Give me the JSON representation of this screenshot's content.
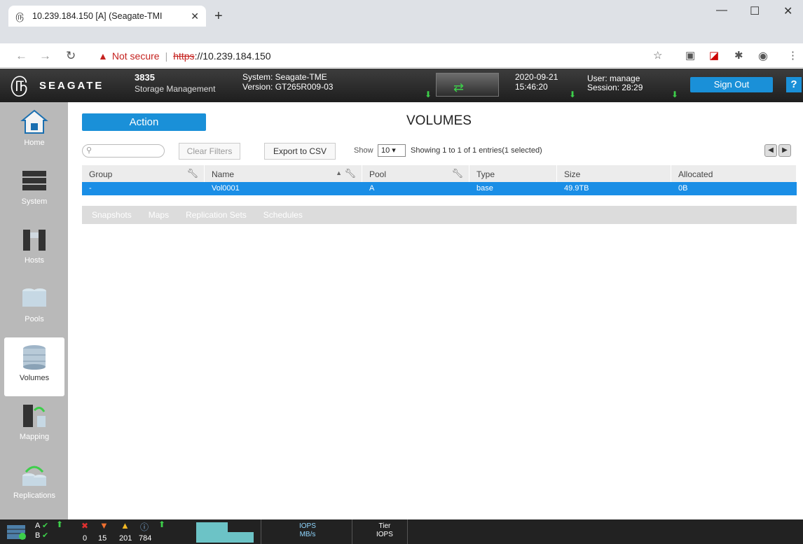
{
  "browser": {
    "tab_title": "10.239.184.150 [A] (Seagate-TMI",
    "new_tab": "+",
    "not_secure": "Not secure",
    "url_scheme": "https",
    "url_host": "://10.239.184.150",
    "window_min": "—",
    "window_max": "☐",
    "window_close": "✕"
  },
  "header": {
    "brand": "SEAGATE",
    "model": "3835",
    "product": "Storage Management",
    "system_label": "System: Seagate-TME",
    "version_label": "Version: GT265R009-03",
    "date": "2020-09-21",
    "time": "15:46:20",
    "user_label": "User: manage",
    "session_label": "Session: 28:29",
    "sign_out": "Sign Out",
    "help": "?"
  },
  "sidebar": {
    "items": [
      {
        "label": "Home"
      },
      {
        "label": "System"
      },
      {
        "label": "Hosts"
      },
      {
        "label": "Pools"
      },
      {
        "label": "Volumes"
      },
      {
        "label": "Mapping"
      },
      {
        "label": "Replications"
      }
    ]
  },
  "main": {
    "action": "Action",
    "title": "VOLUMES",
    "clear_filters": "Clear Filters",
    "export_csv": "Export to CSV",
    "show": "Show",
    "show_value": "10 ▾",
    "entries": "Showing 1 to 1 of 1 entries(1 selected)",
    "columns": [
      "Group",
      "Name",
      "Pool",
      "Type",
      "Size",
      "Allocated"
    ],
    "rows": [
      {
        "group": "-",
        "name": "Vol0001",
        "pool": "A",
        "type": "base",
        "size": "49.9TB",
        "allocated": "0B"
      }
    ],
    "subtabs": [
      "Snapshots",
      "Maps",
      "Replication Sets",
      "Schedules"
    ]
  },
  "statusbar": {
    "ctrl_a": "A",
    "ctrl_b": "B",
    "count_error": "0",
    "count_critical": "15",
    "count_warning": "201",
    "count_info": "784",
    "iops_label": "IOPS",
    "mbs_label": "MB/s",
    "tier_label": "Tier",
    "tier_iops_label": "IOPS"
  },
  "colors": {
    "accent": "#1a90d8",
    "selected_row": "#1a8ee6",
    "header_bg": "#2b2b2b",
    "sidebar_bg": "#b9b9b9"
  }
}
